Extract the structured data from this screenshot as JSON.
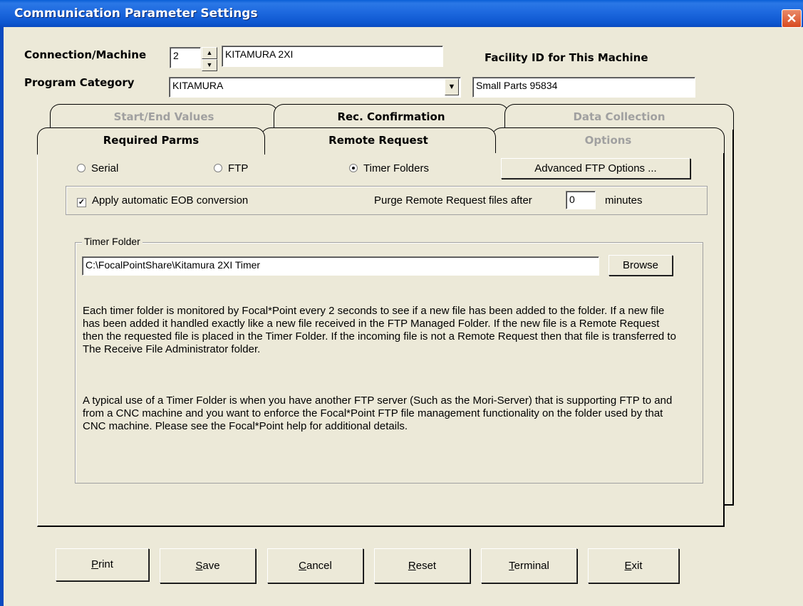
{
  "window": {
    "title": "Communication Parameter Settings",
    "close_glyph": "✕"
  },
  "header": {
    "connection_label": "Connection/Machine",
    "connection_number": "2",
    "machine_name": "KITAMURA 2XI",
    "facility_label": "Facility ID for This Machine",
    "facility_value": "Small Parts 95834",
    "category_label": "Program Category",
    "category_value": "KITAMURA"
  },
  "tabs": {
    "back": [
      {
        "label": "Start/End Values",
        "enabled": false
      },
      {
        "label": "Rec. Confirmation",
        "enabled": true
      },
      {
        "label": "Data Collection",
        "enabled": false
      }
    ],
    "front": [
      {
        "label": "Required Parms",
        "enabled": true,
        "active": true
      },
      {
        "label": "Remote Request",
        "enabled": true
      },
      {
        "label": "Options",
        "enabled": false
      }
    ]
  },
  "required_parms": {
    "radios": [
      {
        "label": "Serial",
        "selected": false
      },
      {
        "label": "FTP",
        "selected": false
      },
      {
        "label": "Timer Folders",
        "selected": true
      }
    ],
    "advanced_button": "Advanced FTP Options ...",
    "eob_checkbox": {
      "label": "Apply automatic EOB conversion",
      "checked": true
    },
    "purge_label": "Purge Remote Request files after",
    "purge_value": "0",
    "purge_unit": "minutes",
    "timer_group_label": "Timer Folder",
    "timer_folder_path": "C:\\FocalPointShare\\Kitamura 2XI Timer",
    "browse_button": "Browse",
    "info_paragraph_1": "Each timer folder is monitored by Focal*Point every 2 seconds to see if a new file has been added to the folder.  If a new file has been added it handled exactly like a new file received in the FTP Managed Folder.  If the new file is a Remote Request then the requested file is placed in the Timer Folder.  If the incoming file is not a Remote Request then that file is transferred to The Receive File Administrator folder.",
    "info_paragraph_2": "A typical use of a Timer Folder is when you have another FTP server (Such as the Mori-Server) that is supporting FTP to and from a CNC machine and you want to enforce the Focal*Point FTP file management functionality on the folder used by that CNC machine.  Please see the Focal*Point help for additional details."
  },
  "footer_buttons": [
    {
      "key": "P",
      "rest": "rint"
    },
    {
      "key": "S",
      "rest": "ave"
    },
    {
      "key": "C",
      "rest": "ancel"
    },
    {
      "key": "R",
      "rest": "eset"
    },
    {
      "key": "T",
      "rest": "erminal"
    },
    {
      "key": "E",
      "rest": "xit"
    }
  ],
  "icons": {
    "spin_up": "▲",
    "spin_down": "▼",
    "dropdown": "▼",
    "check": "✓"
  }
}
